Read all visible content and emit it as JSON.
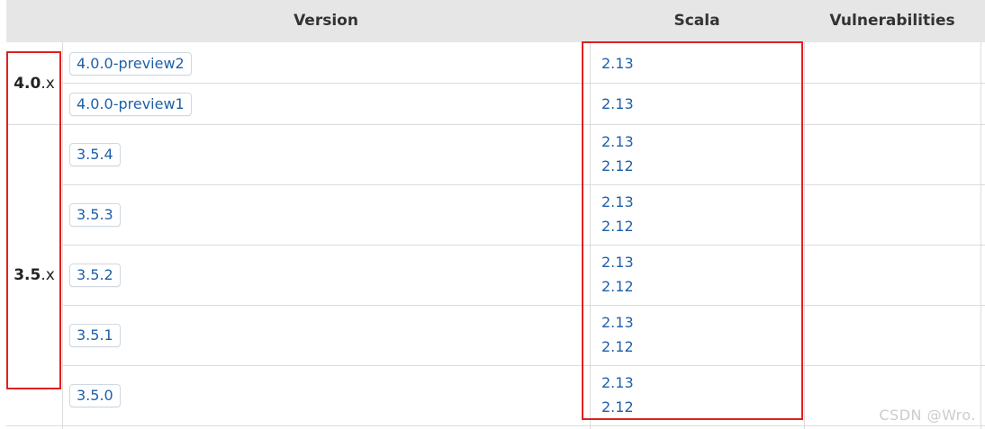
{
  "header": {
    "version": "Version",
    "scala": "Scala",
    "vulnerabilities": "Vulnerabilities"
  },
  "majors": [
    {
      "num": "4.0",
      "suffix": ".x"
    },
    {
      "num": "3.5",
      "suffix": ".x"
    }
  ],
  "rows": [
    {
      "version": "4.0.0-preview2",
      "scala": [
        "2.13"
      ]
    },
    {
      "version": "4.0.0-preview1",
      "scala": [
        "2.13"
      ]
    },
    {
      "version": "3.5.4",
      "scala": [
        "2.13",
        "2.12"
      ]
    },
    {
      "version": "3.5.3",
      "scala": [
        "2.13",
        "2.12"
      ]
    },
    {
      "version": "3.5.2",
      "scala": [
        "2.13",
        "2.12"
      ]
    },
    {
      "version": "3.5.1",
      "scala": [
        "2.13",
        "2.12"
      ]
    },
    {
      "version": "3.5.0",
      "scala": [
        "2.13",
        "2.12"
      ]
    }
  ],
  "watermark": "CSDN @Wro.",
  "colors": {
    "link": "#1f5faa",
    "annotation": "#e02020",
    "header_bg": "#e6e6e6"
  }
}
